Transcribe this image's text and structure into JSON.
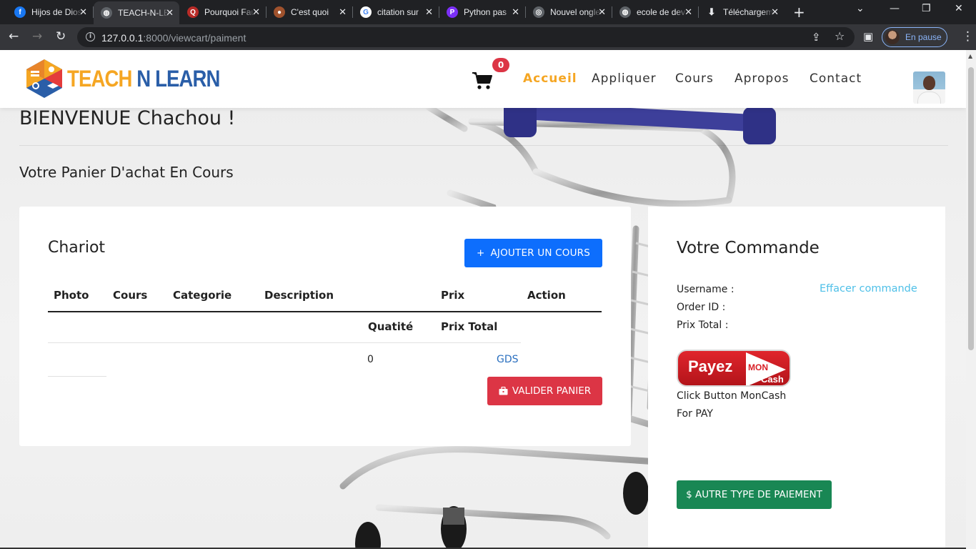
{
  "browser": {
    "tabs": [
      {
        "title": "Hijos de Dios",
        "icon": "facebook-icon",
        "color": "#1877f2",
        "glyph": "f"
      },
      {
        "title": "TEACH-N-LEARN",
        "icon": "globe-icon",
        "color": "#5f6368",
        "glyph": "◍",
        "active": true
      },
      {
        "title": "Pourquoi Faut-il",
        "icon": "quora-icon",
        "color": "#b92b27",
        "glyph": "Q"
      },
      {
        "title": "C'est quoi",
        "icon": "avatar-favicon-icon",
        "color": "#a0522d",
        "glyph": "●"
      },
      {
        "title": "citation sur",
        "icon": "google-icon",
        "color": "#ffffff",
        "glyph": "G"
      },
      {
        "title": "Python pas",
        "icon": "p-brand-icon",
        "color": "#7b2ff7",
        "glyph": "P"
      },
      {
        "title": "Nouvel onglet",
        "icon": "chrome-icon",
        "color": "#5f6368",
        "glyph": "◎"
      },
      {
        "title": "ecole de dev",
        "icon": "globe-icon",
        "color": "#5f6368",
        "glyph": "◍"
      },
      {
        "title": "Téléchargements",
        "icon": "download-icon",
        "color": "#202124",
        "glyph": "⬇"
      }
    ],
    "url_host": "127.0.0.1",
    "url_rest": ":8000/viewcart/paiment",
    "profile_label": "En pause"
  },
  "nav": {
    "logo_part1": "TEACH",
    "logo_part2": " N LEARN",
    "cart_count": "0",
    "links": [
      "Accueil",
      "Appliquer",
      "Cours",
      "Apropos",
      "Contact"
    ]
  },
  "page": {
    "welcome": "BIENVENUE Chachou !",
    "subtitle": "Votre Panier D'achat En Cours"
  },
  "cart": {
    "title": "Chariot",
    "add_button": "AJOUTER UN COURS",
    "columns": [
      "Photo",
      "Cours",
      "Categorie",
      "Description",
      "Prix",
      "Action"
    ],
    "subcolumns": [
      "Quatité",
      "Prix Total"
    ],
    "quantity": "0",
    "currency": "GDS",
    "validate_button": "VALIDER PANIER"
  },
  "order": {
    "title": "Votre Commande",
    "username_label": "Username :",
    "order_id_label": "Order ID :",
    "total_label": "Prix Total :",
    "clear_link": "Effacer commande",
    "moncash_payez": "Payez",
    "moncash_mon": "MON",
    "moncash_cash": "Cash",
    "moncash_line1": "Click Button MonCash",
    "moncash_line2": "For PAY",
    "other_payment_button": "$ AUTRE TYPE DE PAIEMENT"
  },
  "colors": {
    "accent_orange": "#f5a623",
    "brand_blue": "#2a5ea8",
    "primary": "#0d6efd",
    "danger": "#dc3545",
    "success": "#198754",
    "link_cyan": "#4fc0e8"
  }
}
